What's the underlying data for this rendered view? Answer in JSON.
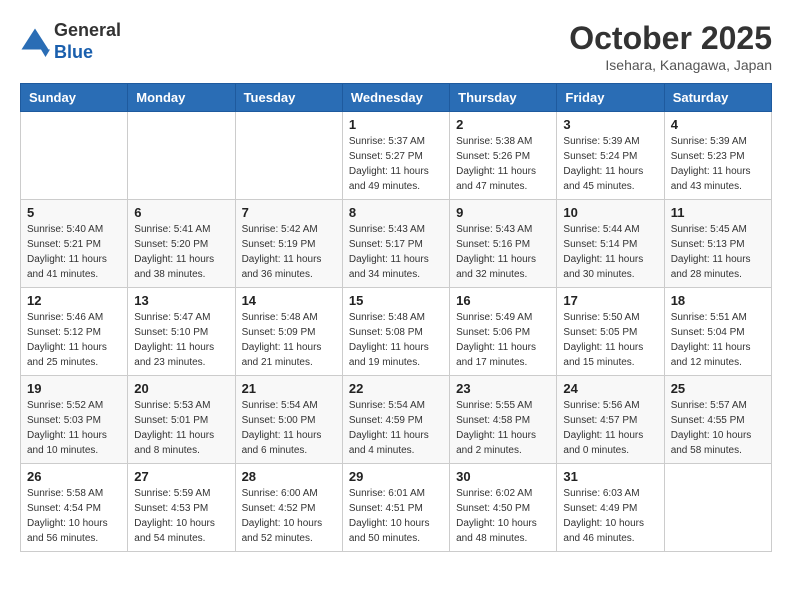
{
  "header": {
    "logo_line1": "General",
    "logo_line2": "Blue",
    "month": "October 2025",
    "location": "Isehara, Kanagawa, Japan"
  },
  "days_of_week": [
    "Sunday",
    "Monday",
    "Tuesday",
    "Wednesday",
    "Thursday",
    "Friday",
    "Saturday"
  ],
  "weeks": [
    [
      {
        "day": "",
        "info": ""
      },
      {
        "day": "",
        "info": ""
      },
      {
        "day": "",
        "info": ""
      },
      {
        "day": "1",
        "info": "Sunrise: 5:37 AM\nSunset: 5:27 PM\nDaylight: 11 hours and 49 minutes."
      },
      {
        "day": "2",
        "info": "Sunrise: 5:38 AM\nSunset: 5:26 PM\nDaylight: 11 hours and 47 minutes."
      },
      {
        "day": "3",
        "info": "Sunrise: 5:39 AM\nSunset: 5:24 PM\nDaylight: 11 hours and 45 minutes."
      },
      {
        "day": "4",
        "info": "Sunrise: 5:39 AM\nSunset: 5:23 PM\nDaylight: 11 hours and 43 minutes."
      }
    ],
    [
      {
        "day": "5",
        "info": "Sunrise: 5:40 AM\nSunset: 5:21 PM\nDaylight: 11 hours and 41 minutes."
      },
      {
        "day": "6",
        "info": "Sunrise: 5:41 AM\nSunset: 5:20 PM\nDaylight: 11 hours and 38 minutes."
      },
      {
        "day": "7",
        "info": "Sunrise: 5:42 AM\nSunset: 5:19 PM\nDaylight: 11 hours and 36 minutes."
      },
      {
        "day": "8",
        "info": "Sunrise: 5:43 AM\nSunset: 5:17 PM\nDaylight: 11 hours and 34 minutes."
      },
      {
        "day": "9",
        "info": "Sunrise: 5:43 AM\nSunset: 5:16 PM\nDaylight: 11 hours and 32 minutes."
      },
      {
        "day": "10",
        "info": "Sunrise: 5:44 AM\nSunset: 5:14 PM\nDaylight: 11 hours and 30 minutes."
      },
      {
        "day": "11",
        "info": "Sunrise: 5:45 AM\nSunset: 5:13 PM\nDaylight: 11 hours and 28 minutes."
      }
    ],
    [
      {
        "day": "12",
        "info": "Sunrise: 5:46 AM\nSunset: 5:12 PM\nDaylight: 11 hours and 25 minutes."
      },
      {
        "day": "13",
        "info": "Sunrise: 5:47 AM\nSunset: 5:10 PM\nDaylight: 11 hours and 23 minutes."
      },
      {
        "day": "14",
        "info": "Sunrise: 5:48 AM\nSunset: 5:09 PM\nDaylight: 11 hours and 21 minutes."
      },
      {
        "day": "15",
        "info": "Sunrise: 5:48 AM\nSunset: 5:08 PM\nDaylight: 11 hours and 19 minutes."
      },
      {
        "day": "16",
        "info": "Sunrise: 5:49 AM\nSunset: 5:06 PM\nDaylight: 11 hours and 17 minutes."
      },
      {
        "day": "17",
        "info": "Sunrise: 5:50 AM\nSunset: 5:05 PM\nDaylight: 11 hours and 15 minutes."
      },
      {
        "day": "18",
        "info": "Sunrise: 5:51 AM\nSunset: 5:04 PM\nDaylight: 11 hours and 12 minutes."
      }
    ],
    [
      {
        "day": "19",
        "info": "Sunrise: 5:52 AM\nSunset: 5:03 PM\nDaylight: 11 hours and 10 minutes."
      },
      {
        "day": "20",
        "info": "Sunrise: 5:53 AM\nSunset: 5:01 PM\nDaylight: 11 hours and 8 minutes."
      },
      {
        "day": "21",
        "info": "Sunrise: 5:54 AM\nSunset: 5:00 PM\nDaylight: 11 hours and 6 minutes."
      },
      {
        "day": "22",
        "info": "Sunrise: 5:54 AM\nSunset: 4:59 PM\nDaylight: 11 hours and 4 minutes."
      },
      {
        "day": "23",
        "info": "Sunrise: 5:55 AM\nSunset: 4:58 PM\nDaylight: 11 hours and 2 minutes."
      },
      {
        "day": "24",
        "info": "Sunrise: 5:56 AM\nSunset: 4:57 PM\nDaylight: 11 hours and 0 minutes."
      },
      {
        "day": "25",
        "info": "Sunrise: 5:57 AM\nSunset: 4:55 PM\nDaylight: 10 hours and 58 minutes."
      }
    ],
    [
      {
        "day": "26",
        "info": "Sunrise: 5:58 AM\nSunset: 4:54 PM\nDaylight: 10 hours and 56 minutes."
      },
      {
        "day": "27",
        "info": "Sunrise: 5:59 AM\nSunset: 4:53 PM\nDaylight: 10 hours and 54 minutes."
      },
      {
        "day": "28",
        "info": "Sunrise: 6:00 AM\nSunset: 4:52 PM\nDaylight: 10 hours and 52 minutes."
      },
      {
        "day": "29",
        "info": "Sunrise: 6:01 AM\nSunset: 4:51 PM\nDaylight: 10 hours and 50 minutes."
      },
      {
        "day": "30",
        "info": "Sunrise: 6:02 AM\nSunset: 4:50 PM\nDaylight: 10 hours and 48 minutes."
      },
      {
        "day": "31",
        "info": "Sunrise: 6:03 AM\nSunset: 4:49 PM\nDaylight: 10 hours and 46 minutes."
      },
      {
        "day": "",
        "info": ""
      }
    ]
  ]
}
